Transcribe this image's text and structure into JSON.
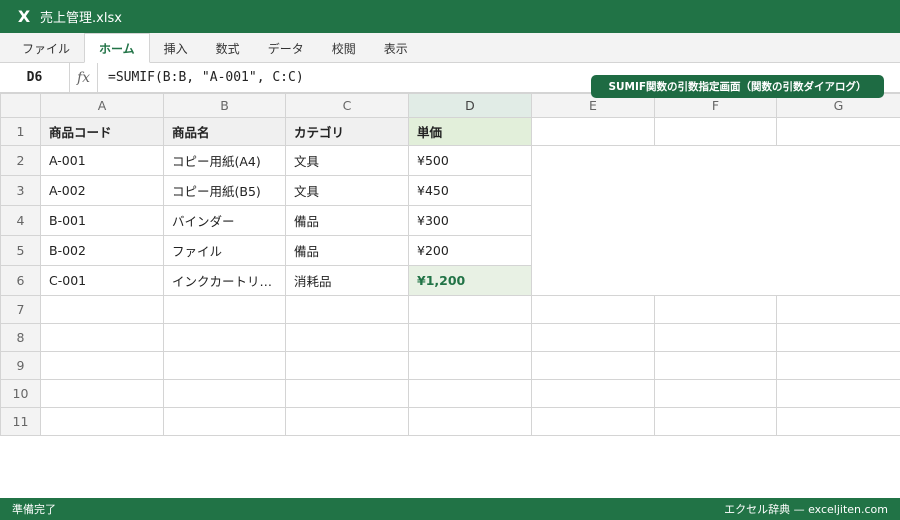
{
  "app": {
    "logo": "X",
    "file_title": "売上管理.xlsx"
  },
  "ribbon": {
    "tabs": [
      "ファイル",
      "ホーム",
      "挿入",
      "数式",
      "データ",
      "校閲",
      "表示"
    ],
    "active_tab": "ホーム"
  },
  "formula_bar": {
    "name_box": "D6",
    "fx_label": "fx",
    "formula": "=SUMIF(B:B, \"A-001\", C:C)"
  },
  "banner": {
    "text": "SUMIF関数の引数指定画面（関数の引数ダイアログ）"
  },
  "grid": {
    "columns": [
      "A",
      "B",
      "C",
      "D",
      "E",
      "F",
      "G"
    ],
    "rows": [
      "1",
      "2",
      "3",
      "4",
      "5",
      "6",
      "7",
      "8",
      "9",
      "10",
      "11"
    ],
    "header": [
      "商品コード",
      "商品名",
      "カテゴリ",
      "単価"
    ],
    "data": [
      [
        "A-001",
        "コピー用紙(A4)",
        "文具",
        "¥500"
      ],
      [
        "A-002",
        "コピー用紙(B5)",
        "文具",
        "¥450"
      ],
      [
        "B-001",
        "バインダー",
        "備品",
        "¥300"
      ],
      [
        "B-002",
        "ファイル",
        "備品",
        "¥200"
      ],
      [
        "C-001",
        "インクカートリ…",
        "消耗品",
        "¥1,200"
      ]
    ],
    "selected_cell": "D6"
  },
  "status_bar": {
    "left": "準備完了",
    "right": "エクセル辞典 — exceljiten.com"
  },
  "colors": {
    "accent": "#217346",
    "banner": "#1e6b43",
    "selected_fill": "#e8f1e4",
    "header_fill_d": "#e2efda"
  }
}
